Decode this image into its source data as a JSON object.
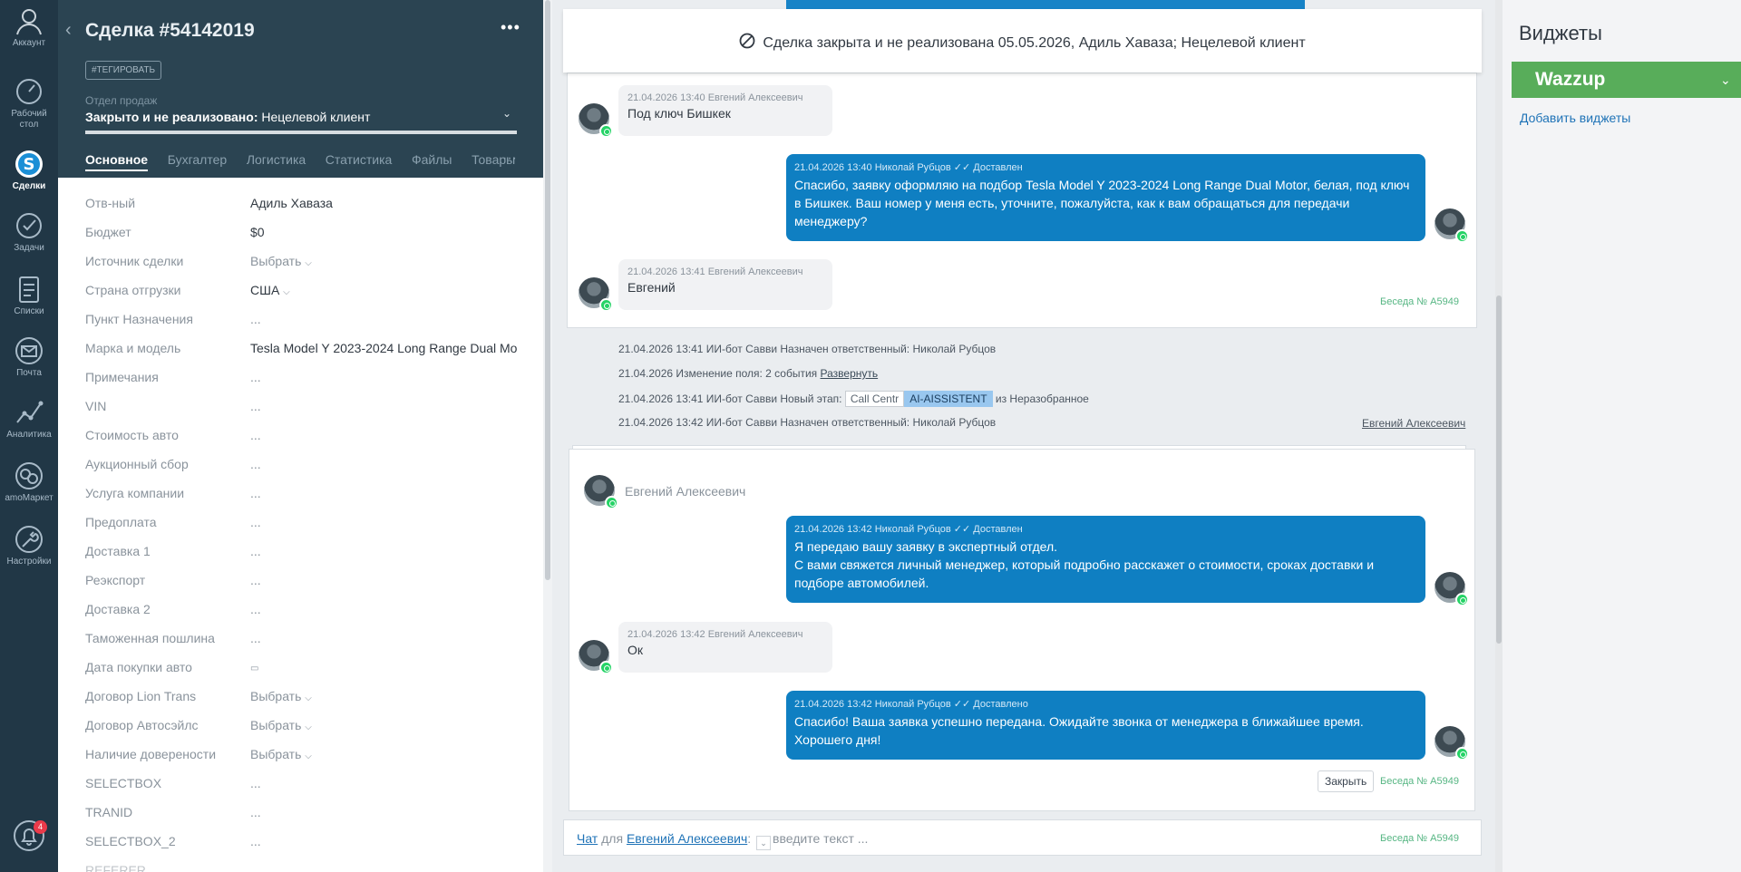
{
  "nav": {
    "items": [
      {
        "label": "Аккаунт",
        "icon": "account-icon"
      },
      {
        "label": "Рабочий стол",
        "icon": "dashboard-icon"
      },
      {
        "label": "Сделки",
        "icon": "deals-icon"
      },
      {
        "label": "Задачи",
        "icon": "tasks-icon"
      },
      {
        "label": "Списки",
        "icon": "lists-icon"
      },
      {
        "label": "Почта",
        "icon": "mail-icon"
      },
      {
        "label": "Аналитика",
        "icon": "analytics-icon"
      },
      {
        "label": "amoМаркет",
        "icon": "market-icon"
      },
      {
        "label": "Настройки",
        "icon": "settings-icon"
      }
    ],
    "notifications_count": "4"
  },
  "card": {
    "title": "Сделка #54142019",
    "tag_button": "#ТЕГИРОВАТЬ",
    "pipeline": "Отдел продаж",
    "status_prefix": "Закрыто и не реализовано:",
    "status_reason": "Нецелевой клиент",
    "tabs": [
      "Основное",
      "Бухгалтер",
      "Логистика",
      "Статистика",
      "Файлы",
      "Товары"
    ],
    "fields": [
      {
        "label": "Отв-ный",
        "value": "Адиль Хаваза"
      },
      {
        "label": "Бюджет",
        "value": "$0"
      },
      {
        "label": "Источник сделки",
        "value": "Выбрать"
      },
      {
        "label": "Страна отгрузки",
        "value": "США"
      },
      {
        "label": "Пункт Назначения",
        "value": "..."
      },
      {
        "label": "Марка и модель",
        "value": "Tesla Model Y 2023-2024 Long Range Dual Mo"
      },
      {
        "label": "Примечания",
        "value": "..."
      },
      {
        "label": "VIN",
        "value": "..."
      },
      {
        "label": "Стоимость авто",
        "value": "..."
      },
      {
        "label": "Аукционный сбор",
        "value": "..."
      },
      {
        "label": "Услуга компании",
        "value": "..."
      },
      {
        "label": "Предоплата",
        "value": "..."
      },
      {
        "label": "Доставка 1",
        "value": "..."
      },
      {
        "label": "Реэкспорт",
        "value": "..."
      },
      {
        "label": "Доставка 2",
        "value": "..."
      },
      {
        "label": "Таможенная пошлина",
        "value": "..."
      },
      {
        "label": "Дата покупки авто",
        "value": "▭"
      },
      {
        "label": "Договор Lion Trans",
        "value": "Выбрать"
      },
      {
        "label": "Договор Автосэйлс",
        "value": "Выбрать"
      },
      {
        "label": "Наличие доверености",
        "value": "Выбрать"
      },
      {
        "label": "SELECTBOX",
        "value": "..."
      },
      {
        "label": "TRANID",
        "value": "..."
      },
      {
        "label": "SELECTBOX_2",
        "value": "..."
      },
      {
        "label": "REFERER",
        "value": ""
      }
    ]
  },
  "feed": {
    "closed_banner": "Сделка закрыта и не реализована 05.05.2026, Адиль Хаваза; Нецелевой клиент",
    "messages_top": [
      {
        "meta": "21.04.2026 13:40 Евгений Алексеевич",
        "text": "Под ключ Бишкек"
      },
      {
        "meta": "21.04.2026 13:40 Николай Рубцов ✓✓ Доставлен",
        "text": "Спасибо, заявку оформляю на подбор Tesla Model Y 2023-2024 Long Range Dual Motor, белая, под ключ в Бишкек. Ваш номер у меня есть, уточните, пожалуйста, как к вам обращаться для передачи менеджеру?"
      },
      {
        "meta": "21.04.2026 13:41 Евгений Алексеевич",
        "text": "Евгений"
      }
    ],
    "convo_label": "Беседа № A5949",
    "system": [
      {
        "text": "21.04.2026 13:41 ИИ-бот Савви Назначен ответственный: Николай Рубцов"
      },
      {
        "text": "21.04.2026 Изменение поля: 2 события",
        "link": "Развернуть"
      },
      {
        "text": "21.04.2026 13:41 ИИ-бот Савви Новый этап:",
        "stage_from": "Call Centr",
        "stage_to": "AI-AISSISTENT",
        "suffix": "из Неразобранное"
      },
      {
        "text": "21.04.2026 13:42 ИИ-бот Савви Назначен ответственный: Николай Рубцов"
      }
    ],
    "system_author": "Евгений Алексеевич",
    "panel2_title": "Евгений Алексеевич",
    "messages_bottom": [
      {
        "meta": "21.04.2026 13:42 Николай Рубцов ✓✓ Доставлен",
        "text": "Я передаю вашу заявку в экспертный отдел.\nС вами свяжется личный менеджер, который подробно расскажет о стоимости, сроках доставки и подборе автомобилей."
      },
      {
        "meta": "21.04.2026 13:42 Евгений Алексеевич",
        "text": "Ок"
      },
      {
        "meta": "21.04.2026 13:42 Николай Рубцов ✓✓ Доставлено",
        "text": "Спасибо! Ваша заявка успешно передана. Ожидайте звонка от менеджера в ближайшее время.\nХорошего дня!"
      }
    ],
    "close_button": "Закрыть",
    "chat": {
      "prefix": "Чат",
      "for": "для",
      "recipient": "Евгений Алексеевич",
      "colon": ":",
      "placeholder": "введите текст ..."
    }
  },
  "widgets": {
    "title": "Виджеты",
    "wazzup": "Wazzup",
    "add_link": "Добавить виджеты"
  },
  "colors": {
    "nav_bg": "#213746",
    "card_header_bg": "#2b4452",
    "outgoing_bubble": "#0f7fc2",
    "wazzup_green": "#58ad5a",
    "convo_green": "#56b683"
  }
}
